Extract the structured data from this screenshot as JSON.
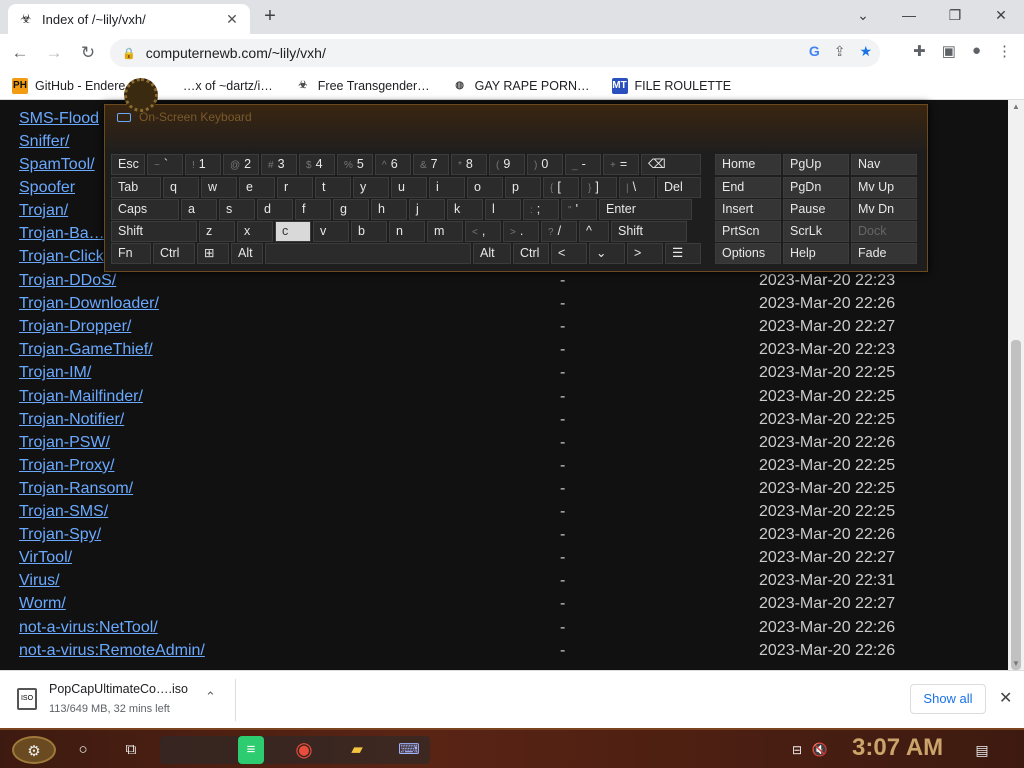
{
  "tab": {
    "title": "Index of /~lily/vxh/",
    "close": "✕"
  },
  "address": {
    "url": "computernewb.com/~lily/vxh/"
  },
  "bookmarks": [
    {
      "icon": "PH",
      "label": "GitHub - Endere…",
      "color": "#f39c12"
    },
    {
      "icon": "",
      "label": "…x of ~dartz/i…",
      "color": "#888"
    },
    {
      "icon": "☣",
      "label": "Free Transgender…",
      "color": "#444"
    },
    {
      "icon": "◍",
      "label": "GAY RAPE PORN…",
      "color": "#444"
    },
    {
      "icon": "MT",
      "label": "FILE ROULETTE",
      "color": "#2a4fbf"
    }
  ],
  "listing_top": [
    "SMS-Flood",
    "Sniffer/",
    "SpamTool/",
    "Spoofer",
    "Trojan/",
    "Trojan-Ba…",
    "Trojan-Click…"
  ],
  "listing": [
    {
      "name": "Trojan-DDoS/",
      "size": "-",
      "date": "2023-Mar-20 22:23"
    },
    {
      "name": "Trojan-Downloader/",
      "size": "-",
      "date": "2023-Mar-20 22:26"
    },
    {
      "name": "Trojan-Dropper/",
      "size": "-",
      "date": "2023-Mar-20 22:27"
    },
    {
      "name": "Trojan-GameThief/",
      "size": "-",
      "date": "2023-Mar-20 22:23"
    },
    {
      "name": "Trojan-IM/",
      "size": "-",
      "date": "2023-Mar-20 22:25"
    },
    {
      "name": "Trojan-Mailfinder/",
      "size": "-",
      "date": "2023-Mar-20 22:25"
    },
    {
      "name": "Trojan-Notifier/",
      "size": "-",
      "date": "2023-Mar-20 22:25"
    },
    {
      "name": "Trojan-PSW/",
      "size": "-",
      "date": "2023-Mar-20 22:26"
    },
    {
      "name": "Trojan-Proxy/",
      "size": "-",
      "date": "2023-Mar-20 22:25"
    },
    {
      "name": "Trojan-Ransom/",
      "size": "-",
      "date": "2023-Mar-20 22:25"
    },
    {
      "name": "Trojan-SMS/",
      "size": "-",
      "date": "2023-Mar-20 22:25"
    },
    {
      "name": "Trojan-Spy/",
      "size": "-",
      "date": "2023-Mar-20 22:26"
    },
    {
      "name": "VirTool/",
      "size": "-",
      "date": "2023-Mar-20 22:27"
    },
    {
      "name": "Virus/",
      "size": "-",
      "date": "2023-Mar-20 22:31"
    },
    {
      "name": "Worm/",
      "size": "-",
      "date": "2023-Mar-20 22:27"
    },
    {
      "name": "not-a-virus:NetTool/",
      "size": "-",
      "date": "2023-Mar-20 22:26"
    },
    {
      "name": "not-a-virus:RemoteAdmin/",
      "size": "-",
      "date": "2023-Mar-20 22:26"
    }
  ],
  "osk": {
    "title": "On-Screen Keyboard",
    "rows": [
      [
        [
          "Esc",
          ""
        ],
        [
          "`",
          "~"
        ],
        [
          "1",
          "!"
        ],
        [
          "2",
          "@"
        ],
        [
          "3",
          "#"
        ],
        [
          "4",
          "$"
        ],
        [
          "5",
          "%"
        ],
        [
          "6",
          "^"
        ],
        [
          "7",
          "&"
        ],
        [
          "8",
          "*"
        ],
        [
          "9",
          "("
        ],
        [
          "0",
          ")"
        ],
        [
          "-",
          "_"
        ],
        [
          "=",
          "+"
        ],
        [
          "⌫",
          ""
        ]
      ],
      [
        [
          "Tab",
          ""
        ],
        [
          "q",
          ""
        ],
        [
          "w",
          ""
        ],
        [
          "e",
          ""
        ],
        [
          "r",
          ""
        ],
        [
          "t",
          ""
        ],
        [
          "y",
          ""
        ],
        [
          "u",
          ""
        ],
        [
          "i",
          ""
        ],
        [
          "o",
          ""
        ],
        [
          "p",
          ""
        ],
        [
          "[",
          "{"
        ],
        [
          "]",
          "}"
        ],
        [
          "\\",
          "|"
        ],
        [
          "Del",
          ""
        ]
      ],
      [
        [
          "Caps",
          ""
        ],
        [
          "a",
          ""
        ],
        [
          "s",
          ""
        ],
        [
          "d",
          ""
        ],
        [
          "f",
          ""
        ],
        [
          "g",
          ""
        ],
        [
          "h",
          ""
        ],
        [
          "j",
          ""
        ],
        [
          "k",
          ""
        ],
        [
          "l",
          ""
        ],
        [
          ";",
          ":"
        ],
        [
          "'",
          "\""
        ],
        [
          "Enter",
          ""
        ]
      ],
      [
        [
          "Shift",
          ""
        ],
        [
          "z",
          ""
        ],
        [
          "x",
          ""
        ],
        [
          "c",
          ""
        ],
        [
          "v",
          ""
        ],
        [
          "b",
          ""
        ],
        [
          "n",
          ""
        ],
        [
          "m",
          ""
        ],
        [
          ",",
          "<"
        ],
        [
          ".",
          ">"
        ],
        [
          "/",
          "?"
        ],
        [
          "^",
          ""
        ],
        [
          "Shift",
          ""
        ]
      ],
      [
        [
          "Fn",
          ""
        ],
        [
          "Ctrl",
          ""
        ],
        [
          "⊞",
          ""
        ],
        [
          "Alt",
          ""
        ],
        [
          "",
          ""
        ],
        [
          "Alt",
          ""
        ],
        [
          "Ctrl",
          ""
        ],
        [
          "<",
          ""
        ],
        [
          "⌄",
          ""
        ],
        [
          ">",
          ""
        ],
        [
          "☰",
          ""
        ]
      ]
    ],
    "nav": [
      [
        "Home",
        "PgUp",
        "Nav"
      ],
      [
        "End",
        "PgDn",
        "Mv Up"
      ],
      [
        "Insert",
        "Pause",
        "Mv Dn"
      ],
      [
        "PrtScn",
        "ScrLk",
        "Dock"
      ],
      [
        "Options",
        "Help",
        "Fade"
      ]
    ]
  },
  "download": {
    "file": "PopCapUltimateCo….iso",
    "status": "113/649 MB, 32 mins left",
    "show_all": "Show all",
    "ext": "ISO"
  },
  "taskbar": {
    "clock": "3:07 AM"
  }
}
